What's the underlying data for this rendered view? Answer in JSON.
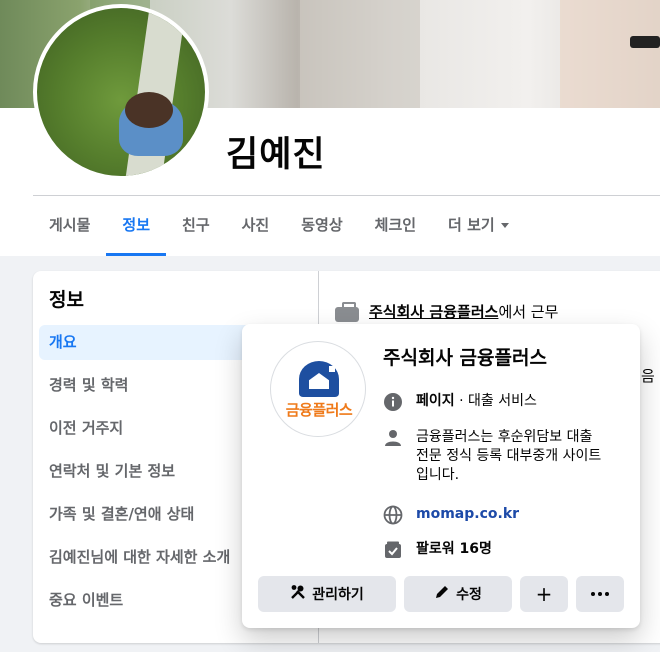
{
  "profile": {
    "name": "김예진"
  },
  "tabs": [
    {
      "label": "게시물",
      "active": false
    },
    {
      "label": "정보",
      "active": true
    },
    {
      "label": "친구",
      "active": false
    },
    {
      "label": "사진",
      "active": false
    },
    {
      "label": "동영상",
      "active": false
    },
    {
      "label": "체크인",
      "active": false
    },
    {
      "label": "더 보기",
      "active": false
    }
  ],
  "about": {
    "heading": "정보",
    "menu": [
      "개요",
      "경력 및 학력",
      "이전 거주지",
      "연락처 및 기본 정보",
      "가족 및 결혼/연애 상태",
      "김예진님에 대한 자세한 소개",
      "중요 이벤트"
    ],
    "work": {
      "company": "주식회사 금융플러스",
      "suffix": "에서 근무"
    },
    "peek_text": "음"
  },
  "hover_card": {
    "title": "주식회사 금융플러스",
    "logo_text": "금융플러스",
    "category_label": "페이지",
    "category_sep": " · ",
    "category_value": "대출 서비스",
    "description": "금융플러스는 후순위담보 대출 전문 정식 등록 대부중개 사이트입니다.",
    "website": "momap.co.kr",
    "followers": "팔로워 16명",
    "actions": {
      "manage": "관리하기",
      "edit": "수정",
      "add": "+"
    }
  },
  "colors": {
    "accent": "#1877f2",
    "link": "#1d4aa8",
    "logo_orange": "#ef7a1a",
    "logo_blue": "#1e4fa0"
  }
}
